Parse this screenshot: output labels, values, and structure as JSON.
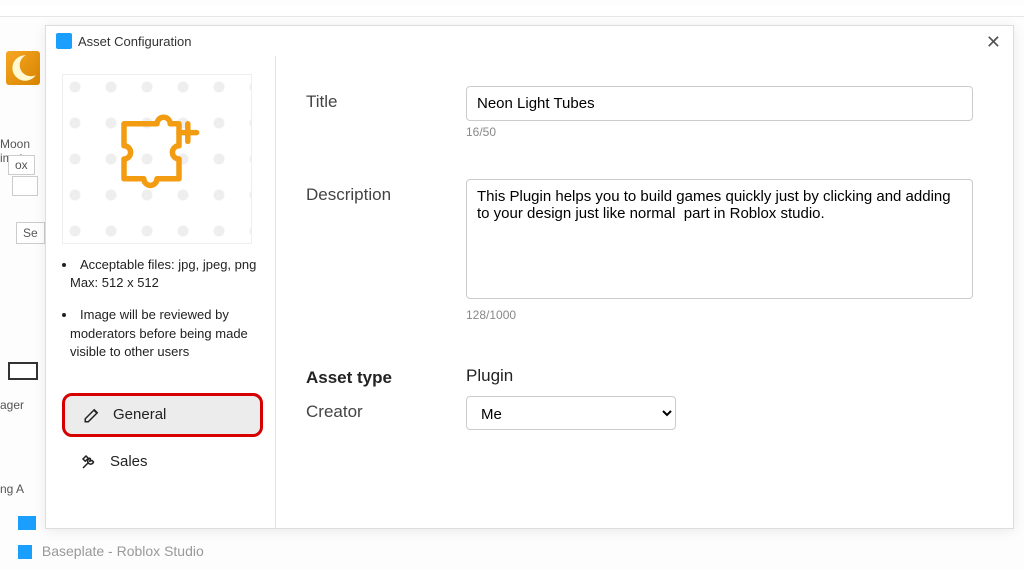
{
  "background": {
    "footer": "Baseplate - Roblox Studio",
    "moon_label_1": "Moon",
    "moon_label_2": "imat",
    "ox": "ox",
    "se": "Se",
    "ager": "ager",
    "ng": "ng A"
  },
  "modal": {
    "title": "Asset Configuration",
    "close": "✕"
  },
  "left": {
    "note1": "Acceptable files: jpg, jpeg, png\nMax: 512 x 512",
    "note2": "Image will be reviewed by moderators before being made visible to other users",
    "tabs": [
      {
        "icon": "edit-icon",
        "label": "General",
        "active": true
      },
      {
        "icon": "tools-icon",
        "label": "Sales",
        "active": false
      }
    ]
  },
  "form": {
    "title_label": "Title",
    "title_value": "Neon Light Tubes",
    "title_counter": "16/50",
    "desc_label": "Description",
    "desc_value": "This Plugin helps you to build games quickly just by clicking and adding to your design just like normal  part in Roblox studio.",
    "desc_counter": "128/1000",
    "asset_type_label": "Asset type",
    "asset_type_value": "Plugin",
    "creator_label": "Creator",
    "creator_value": "Me",
    "creator_options": [
      "Me"
    ]
  }
}
